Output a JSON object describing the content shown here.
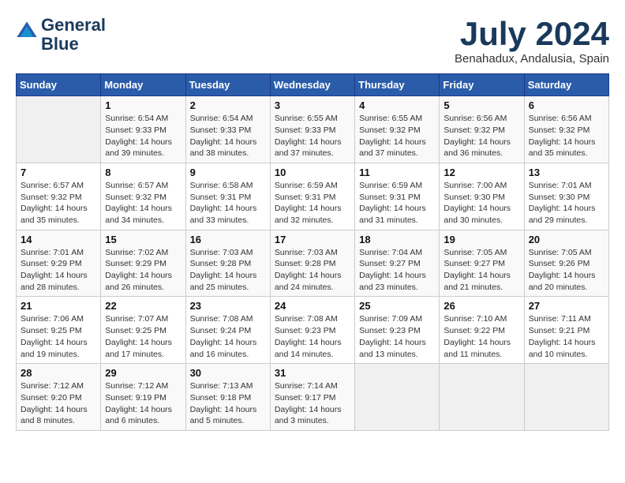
{
  "header": {
    "logo_line1": "General",
    "logo_line2": "Blue",
    "month": "July 2024",
    "location": "Benahadux, Andalusia, Spain"
  },
  "weekdays": [
    "Sunday",
    "Monday",
    "Tuesday",
    "Wednesday",
    "Thursday",
    "Friday",
    "Saturday"
  ],
  "weeks": [
    [
      {
        "day": "",
        "info": ""
      },
      {
        "day": "1",
        "info": "Sunrise: 6:54 AM\nSunset: 9:33 PM\nDaylight: 14 hours\nand 39 minutes."
      },
      {
        "day": "2",
        "info": "Sunrise: 6:54 AM\nSunset: 9:33 PM\nDaylight: 14 hours\nand 38 minutes."
      },
      {
        "day": "3",
        "info": "Sunrise: 6:55 AM\nSunset: 9:33 PM\nDaylight: 14 hours\nand 37 minutes."
      },
      {
        "day": "4",
        "info": "Sunrise: 6:55 AM\nSunset: 9:32 PM\nDaylight: 14 hours\nand 37 minutes."
      },
      {
        "day": "5",
        "info": "Sunrise: 6:56 AM\nSunset: 9:32 PM\nDaylight: 14 hours\nand 36 minutes."
      },
      {
        "day": "6",
        "info": "Sunrise: 6:56 AM\nSunset: 9:32 PM\nDaylight: 14 hours\nand 35 minutes."
      }
    ],
    [
      {
        "day": "7",
        "info": "Sunrise: 6:57 AM\nSunset: 9:32 PM\nDaylight: 14 hours\nand 35 minutes."
      },
      {
        "day": "8",
        "info": "Sunrise: 6:57 AM\nSunset: 9:32 PM\nDaylight: 14 hours\nand 34 minutes."
      },
      {
        "day": "9",
        "info": "Sunrise: 6:58 AM\nSunset: 9:31 PM\nDaylight: 14 hours\nand 33 minutes."
      },
      {
        "day": "10",
        "info": "Sunrise: 6:59 AM\nSunset: 9:31 PM\nDaylight: 14 hours\nand 32 minutes."
      },
      {
        "day": "11",
        "info": "Sunrise: 6:59 AM\nSunset: 9:31 PM\nDaylight: 14 hours\nand 31 minutes."
      },
      {
        "day": "12",
        "info": "Sunrise: 7:00 AM\nSunset: 9:30 PM\nDaylight: 14 hours\nand 30 minutes."
      },
      {
        "day": "13",
        "info": "Sunrise: 7:01 AM\nSunset: 9:30 PM\nDaylight: 14 hours\nand 29 minutes."
      }
    ],
    [
      {
        "day": "14",
        "info": "Sunrise: 7:01 AM\nSunset: 9:29 PM\nDaylight: 14 hours\nand 28 minutes."
      },
      {
        "day": "15",
        "info": "Sunrise: 7:02 AM\nSunset: 9:29 PM\nDaylight: 14 hours\nand 26 minutes."
      },
      {
        "day": "16",
        "info": "Sunrise: 7:03 AM\nSunset: 9:28 PM\nDaylight: 14 hours\nand 25 minutes."
      },
      {
        "day": "17",
        "info": "Sunrise: 7:03 AM\nSunset: 9:28 PM\nDaylight: 14 hours\nand 24 minutes."
      },
      {
        "day": "18",
        "info": "Sunrise: 7:04 AM\nSunset: 9:27 PM\nDaylight: 14 hours\nand 23 minutes."
      },
      {
        "day": "19",
        "info": "Sunrise: 7:05 AM\nSunset: 9:27 PM\nDaylight: 14 hours\nand 21 minutes."
      },
      {
        "day": "20",
        "info": "Sunrise: 7:05 AM\nSunset: 9:26 PM\nDaylight: 14 hours\nand 20 minutes."
      }
    ],
    [
      {
        "day": "21",
        "info": "Sunrise: 7:06 AM\nSunset: 9:25 PM\nDaylight: 14 hours\nand 19 minutes."
      },
      {
        "day": "22",
        "info": "Sunrise: 7:07 AM\nSunset: 9:25 PM\nDaylight: 14 hours\nand 17 minutes."
      },
      {
        "day": "23",
        "info": "Sunrise: 7:08 AM\nSunset: 9:24 PM\nDaylight: 14 hours\nand 16 minutes."
      },
      {
        "day": "24",
        "info": "Sunrise: 7:08 AM\nSunset: 9:23 PM\nDaylight: 14 hours\nand 14 minutes."
      },
      {
        "day": "25",
        "info": "Sunrise: 7:09 AM\nSunset: 9:23 PM\nDaylight: 14 hours\nand 13 minutes."
      },
      {
        "day": "26",
        "info": "Sunrise: 7:10 AM\nSunset: 9:22 PM\nDaylight: 14 hours\nand 11 minutes."
      },
      {
        "day": "27",
        "info": "Sunrise: 7:11 AM\nSunset: 9:21 PM\nDaylight: 14 hours\nand 10 minutes."
      }
    ],
    [
      {
        "day": "28",
        "info": "Sunrise: 7:12 AM\nSunset: 9:20 PM\nDaylight: 14 hours\nand 8 minutes."
      },
      {
        "day": "29",
        "info": "Sunrise: 7:12 AM\nSunset: 9:19 PM\nDaylight: 14 hours\nand 6 minutes."
      },
      {
        "day": "30",
        "info": "Sunrise: 7:13 AM\nSunset: 9:18 PM\nDaylight: 14 hours\nand 5 minutes."
      },
      {
        "day": "31",
        "info": "Sunrise: 7:14 AM\nSunset: 9:17 PM\nDaylight: 14 hours\nand 3 minutes."
      },
      {
        "day": "",
        "info": ""
      },
      {
        "day": "",
        "info": ""
      },
      {
        "day": "",
        "info": ""
      }
    ]
  ]
}
